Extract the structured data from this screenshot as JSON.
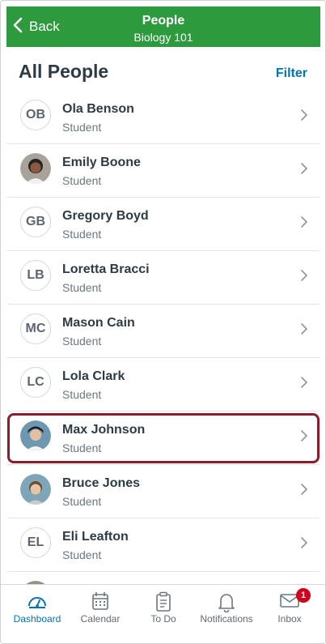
{
  "header": {
    "back_label": "Back",
    "title": "People",
    "subtitle": "Biology 101",
    "color": "#2d9a3d"
  },
  "section": {
    "title": "All People",
    "filter_label": "Filter"
  },
  "people": [
    {
      "initials": "OB",
      "name": "Ola Benson",
      "role": "Student"
    },
    {
      "initials": "",
      "name": "Emily Boone",
      "role": "Student"
    },
    {
      "initials": "GB",
      "name": "Gregory Boyd",
      "role": "Student"
    },
    {
      "initials": "LB",
      "name": "Loretta Bracci",
      "role": "Student"
    },
    {
      "initials": "MC",
      "name": "Mason Cain",
      "role": "Student"
    },
    {
      "initials": "LC",
      "name": "Lola Clark",
      "role": "Student"
    },
    {
      "initials": "",
      "name": "Max Johnson",
      "role": "Student"
    },
    {
      "initials": "",
      "name": "Bruce Jones",
      "role": "Student"
    },
    {
      "initials": "EL",
      "name": "Eli Leafton",
      "role": "Student"
    }
  ],
  "tabs": [
    {
      "label": "Dashboard",
      "icon": "dashboard-icon"
    },
    {
      "label": "Calendar",
      "icon": "calendar-icon"
    },
    {
      "label": "To Do",
      "icon": "todo-icon"
    },
    {
      "label": "Notifications",
      "icon": "bell-icon"
    },
    {
      "label": "Inbox",
      "icon": "inbox-icon",
      "badge": "1"
    }
  ],
  "colors": {
    "accent": "#0374b5",
    "highlight": "#8b1e2b",
    "badge": "#d0021b"
  }
}
